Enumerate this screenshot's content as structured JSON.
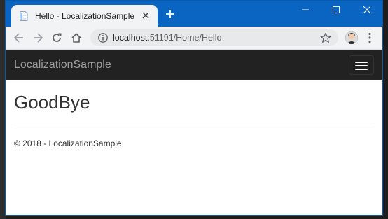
{
  "browser": {
    "tab": {
      "title": "Hello - LocalizationSample",
      "favicon": "document-icon"
    },
    "address_bar": {
      "host": "localhost",
      "rest": ":51191/Home/Hello"
    },
    "colors": {
      "titlebar": "#0a64c2",
      "toolbar": "#f1f3f4"
    }
  },
  "page": {
    "navbar": {
      "brand": "LocalizationSample"
    },
    "heading": "GoodBye",
    "footer": "© 2018 - LocalizationSample",
    "colors": {
      "navbar_bg": "#222222",
      "brand_text": "#9d9d9d"
    }
  }
}
